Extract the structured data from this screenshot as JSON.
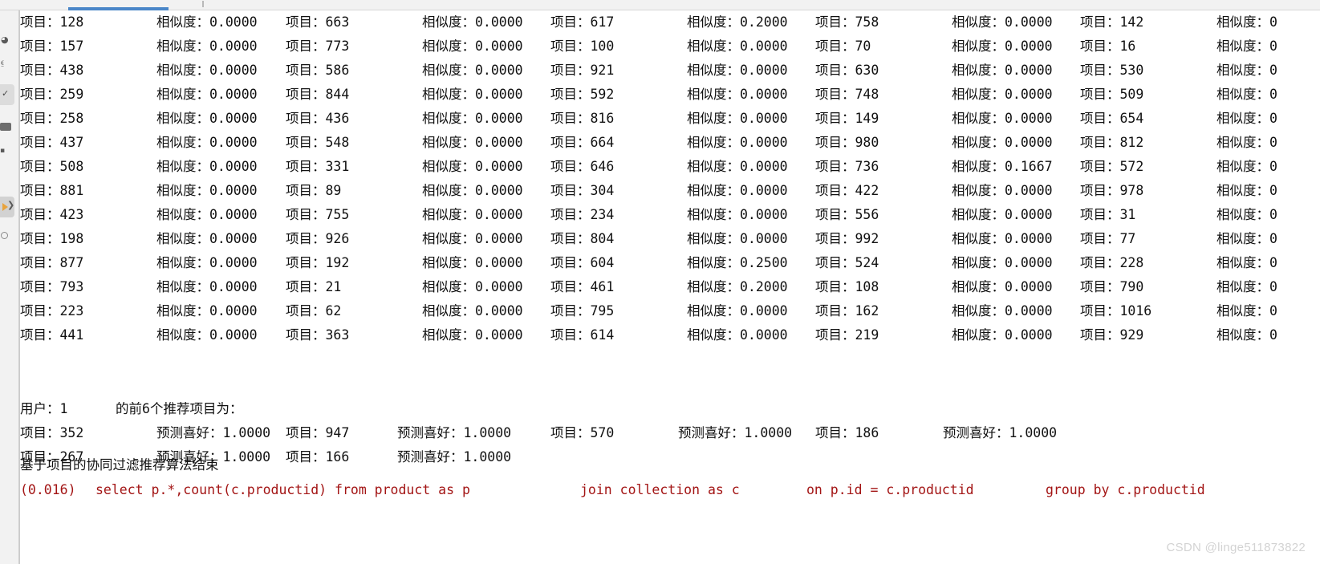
{
  "app": {
    "kind": "ide-console-output",
    "accent_color": "#4a86c8",
    "sql_color": "#9b2226",
    "watermark": "CSDN @linge511873822"
  },
  "left_rail": {
    "items": [
      {
        "name": "structure-icon",
        "glyph": "⎙"
      },
      {
        "name": "bookmark-icon",
        "glyph": "⚑"
      },
      {
        "name": "database-icon",
        "glyph": "⛁"
      },
      {
        "name": "check-icon",
        "glyph": "✓"
      },
      {
        "name": "terminal-icon",
        "glyph": "■"
      },
      {
        "name": "notifications-icon",
        "glyph": "▪"
      },
      {
        "name": "run-icon",
        "glyph": "▶"
      },
      {
        "name": "clock-icon",
        "glyph": "○"
      }
    ]
  },
  "labels": {
    "item": "项目：",
    "similarity": "相似度：",
    "predicted": "预测喜好：",
    "user": "用户：",
    "top_n_suffix": "的前6个推荐项目为：",
    "algo_end": "基于项目的协同过滤推荐算法结束"
  },
  "similarity_grid": {
    "columns": 5,
    "rows": 14,
    "note": "column 5 similarity values are clipped at the right window edge, showing only '0'",
    "column_1": [
      {
        "item": "128",
        "sim": "0.0000"
      },
      {
        "item": "157",
        "sim": "0.0000"
      },
      {
        "item": "438",
        "sim": "0.0000"
      },
      {
        "item": "259",
        "sim": "0.0000"
      },
      {
        "item": "258",
        "sim": "0.0000"
      },
      {
        "item": "437",
        "sim": "0.0000"
      },
      {
        "item": "508",
        "sim": "0.0000"
      },
      {
        "item": "881",
        "sim": "0.0000"
      },
      {
        "item": "423",
        "sim": "0.0000"
      },
      {
        "item": "198",
        "sim": "0.0000"
      },
      {
        "item": "877",
        "sim": "0.0000"
      },
      {
        "item": "793",
        "sim": "0.0000"
      },
      {
        "item": "223",
        "sim": "0.0000"
      },
      {
        "item": "441",
        "sim": "0.0000"
      }
    ],
    "column_2": [
      {
        "item": "663",
        "sim": "0.0000"
      },
      {
        "item": "773",
        "sim": "0.0000"
      },
      {
        "item": "586",
        "sim": "0.0000"
      },
      {
        "item": "844",
        "sim": "0.0000"
      },
      {
        "item": "436",
        "sim": "0.0000"
      },
      {
        "item": "548",
        "sim": "0.0000"
      },
      {
        "item": "331",
        "sim": "0.0000"
      },
      {
        "item": "89",
        "sim": "0.0000"
      },
      {
        "item": "755",
        "sim": "0.0000"
      },
      {
        "item": "926",
        "sim": "0.0000"
      },
      {
        "item": "192",
        "sim": "0.0000"
      },
      {
        "item": "21",
        "sim": "0.0000"
      },
      {
        "item": "62",
        "sim": "0.0000"
      },
      {
        "item": "363",
        "sim": "0.0000"
      }
    ],
    "column_3": [
      {
        "item": "617",
        "sim": "0.2000"
      },
      {
        "item": "100",
        "sim": "0.0000"
      },
      {
        "item": "921",
        "sim": "0.0000"
      },
      {
        "item": "592",
        "sim": "0.0000"
      },
      {
        "item": "816",
        "sim": "0.0000"
      },
      {
        "item": "664",
        "sim": "0.0000"
      },
      {
        "item": "646",
        "sim": "0.0000"
      },
      {
        "item": "304",
        "sim": "0.0000"
      },
      {
        "item": "234",
        "sim": "0.0000"
      },
      {
        "item": "804",
        "sim": "0.0000"
      },
      {
        "item": "604",
        "sim": "0.2500"
      },
      {
        "item": "461",
        "sim": "0.2000"
      },
      {
        "item": "795",
        "sim": "0.0000"
      },
      {
        "item": "614",
        "sim": "0.0000"
      }
    ],
    "column_4": [
      {
        "item": "758",
        "sim": "0.0000"
      },
      {
        "item": "70",
        "sim": "0.0000"
      },
      {
        "item": "630",
        "sim": "0.0000"
      },
      {
        "item": "748",
        "sim": "0.0000"
      },
      {
        "item": "149",
        "sim": "0.0000"
      },
      {
        "item": "980",
        "sim": "0.0000"
      },
      {
        "item": "736",
        "sim": "0.1667"
      },
      {
        "item": "422",
        "sim": "0.0000"
      },
      {
        "item": "556",
        "sim": "0.0000"
      },
      {
        "item": "992",
        "sim": "0.0000"
      },
      {
        "item": "524",
        "sim": "0.0000"
      },
      {
        "item": "108",
        "sim": "0.0000"
      },
      {
        "item": "162",
        "sim": "0.0000"
      },
      {
        "item": "219",
        "sim": "0.0000"
      }
    ],
    "column_5": [
      {
        "item": "142",
        "sim": "0"
      },
      {
        "item": "16",
        "sim": "0"
      },
      {
        "item": "530",
        "sim": "0"
      },
      {
        "item": "509",
        "sim": "0"
      },
      {
        "item": "654",
        "sim": "0"
      },
      {
        "item": "812",
        "sim": "0"
      },
      {
        "item": "572",
        "sim": "0"
      },
      {
        "item": "978",
        "sim": "0"
      },
      {
        "item": "31",
        "sim": "0"
      },
      {
        "item": "77",
        "sim": "0"
      },
      {
        "item": "228",
        "sim": "0"
      },
      {
        "item": "790",
        "sim": "0"
      },
      {
        "item": "1016",
        "sim": "0"
      },
      {
        "item": "929",
        "sim": "0"
      }
    ]
  },
  "recommendations": {
    "user_id": "1",
    "header_text": "用户：1      的前6个推荐项目为：",
    "items": [
      {
        "item": "352",
        "score": "1.0000"
      },
      {
        "item": "947",
        "score": "1.0000"
      },
      {
        "item": "570",
        "score": "1.0000"
      },
      {
        "item": "186",
        "score": "1.0000"
      },
      {
        "item": "267",
        "score": "1.0000"
      },
      {
        "item": "166",
        "score": "1.0000"
      }
    ]
  },
  "footer": {
    "algo_end_text": "基于项目的协同过滤推荐算法结束",
    "sql_timing": "(0.016)",
    "sql_part_1": "select p.*,count(c.productid) from product as p",
    "sql_part_2": "join collection as c",
    "sql_part_3": "on p.id = c.productid",
    "sql_part_4": "group by c.productid"
  }
}
